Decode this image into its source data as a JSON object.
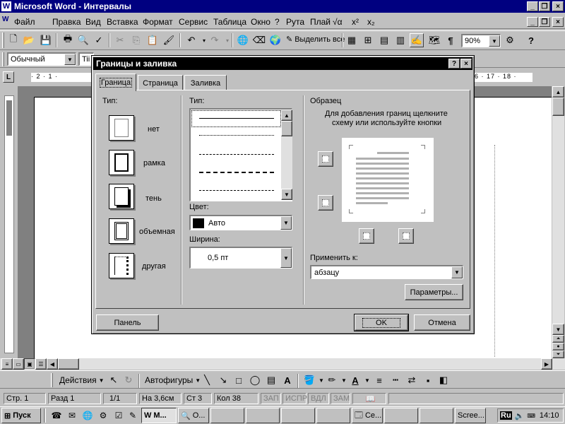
{
  "window": {
    "app_title": "Microsoft Word - Интервалы"
  },
  "menu": {
    "items": [
      "Файл",
      "Правка",
      "Вид",
      "Вставка",
      "Формат",
      "Сервис",
      "Таблица",
      "Окно",
      "?",
      "Рута",
      "Плай"
    ],
    "sqrt_label": "√α",
    "sup_label": "x²",
    "sub_label": "x₂"
  },
  "toolbar": {
    "select_all_label": "Выделить все",
    "zoom_value": "90%"
  },
  "format_toolbar": {
    "style_value": "Обычный",
    "font_value": "Tii"
  },
  "ruler": {
    "left_marks": "· 2 · 1 · ",
    "right_marks": "6 · 17 · 18 ·"
  },
  "dialog": {
    "title": "Границы и заливка",
    "help_label": "?",
    "close_label": "×",
    "tabs": [
      "Граница",
      "Страница",
      "Заливка"
    ],
    "active_tab": "Граница",
    "setting": {
      "label": "Тип:",
      "options": [
        "нет",
        "рамка",
        "тень",
        "объемная",
        "другая"
      ]
    },
    "style": {
      "label": "Тип:",
      "line_styles": [
        "solid",
        "dotted",
        "dashed",
        "dashed-long",
        "dash-dot"
      ]
    },
    "color": {
      "label": "Цвет:",
      "value": "Авто",
      "swatch": "#000000"
    },
    "width": {
      "label": "Ширина:",
      "value": "0,5 пт"
    },
    "preview": {
      "label": "Образец",
      "hint_line1": "Для добавления границ щелкните",
      "hint_line2": "схему или используйте кнопки"
    },
    "apply_to": {
      "label": "Применить к:",
      "value": "абзацу"
    },
    "options_button": "Параметры...",
    "panel_button": "Панель",
    "ok_button": "OK",
    "cancel_button": "Отмена"
  },
  "drawing_toolbar": {
    "actions_label": "Действия",
    "autoshapes_label": "Автофигуры"
  },
  "status": {
    "page": "Стр. 1",
    "section": "Разд 1",
    "pages": "1/1",
    "at": "На 3,6см",
    "line": "Ст 3",
    "col": "Кол 38",
    "rec": "ЗАП",
    "trk": "ИСПР",
    "ext": "ВДЛ",
    "ovr": "ЗАМ"
  },
  "taskbar": {
    "start_label": "Пуск",
    "tasks": [
      "M...",
      "O...",
      "Ce...",
      "Scree..."
    ],
    "lang": "Ru",
    "clock": "14:10"
  },
  "colors": {
    "desktop_title": "#000080",
    "dialog_title": "#000000",
    "face": "#c0c0c0"
  }
}
